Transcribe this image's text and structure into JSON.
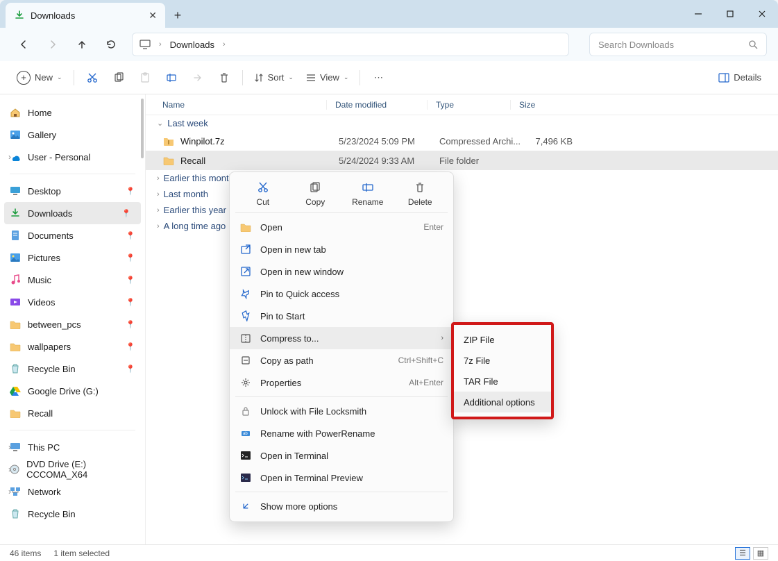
{
  "window": {
    "tab_title": "Downloads",
    "breadcrumb": [
      "Downloads"
    ],
    "search_placeholder": "Search Downloads"
  },
  "toolbar": {
    "new": "New",
    "sort": "Sort",
    "view": "View",
    "details": "Details"
  },
  "sidebar": {
    "top": [
      {
        "label": "Home",
        "icon": "home"
      },
      {
        "label": "Gallery",
        "icon": "gallery"
      },
      {
        "label": "User - Personal",
        "icon": "onedrive"
      }
    ],
    "quick": [
      {
        "label": "Desktop",
        "icon": "desktop"
      },
      {
        "label": "Downloads",
        "icon": "downloads",
        "active": true
      },
      {
        "label": "Documents",
        "icon": "documents"
      },
      {
        "label": "Pictures",
        "icon": "pictures"
      },
      {
        "label": "Music",
        "icon": "music"
      },
      {
        "label": "Videos",
        "icon": "videos"
      },
      {
        "label": "between_pcs",
        "icon": "folder"
      },
      {
        "label": "wallpapers",
        "icon": "folder"
      },
      {
        "label": "Recycle Bin",
        "icon": "recycle"
      },
      {
        "label": "Google Drive (G:)",
        "icon": "gdrive"
      },
      {
        "label": "Recall",
        "icon": "folder"
      }
    ],
    "bottom": [
      {
        "label": "This PC",
        "icon": "pc"
      },
      {
        "label": "DVD Drive (E:) CCCOMA_X64",
        "icon": "dvd"
      },
      {
        "label": "Network",
        "icon": "network"
      },
      {
        "label": "Recycle Bin",
        "icon": "recycle"
      }
    ]
  },
  "columns": {
    "name": "Name",
    "date": "Date modified",
    "type": "Type",
    "size": "Size"
  },
  "groups": [
    {
      "label": "Last week",
      "expanded": true,
      "rows": [
        {
          "name": "Winpilot.7z",
          "date": "5/23/2024 5:09 PM",
          "type": "Compressed Archi...",
          "size": "7,496 KB",
          "icon": "archive"
        },
        {
          "name": "Recall",
          "date": "5/24/2024 9:33 AM",
          "type": "File folder",
          "size": "",
          "icon": "folder",
          "selected": true
        }
      ]
    },
    {
      "label": "Earlier this month",
      "expanded": false
    },
    {
      "label": "Last month",
      "expanded": false
    },
    {
      "label": "Earlier this year",
      "expanded": false
    },
    {
      "label": "A long time ago",
      "expanded": false
    }
  ],
  "context_menu": {
    "top": [
      {
        "label": "Cut",
        "icon": "cut"
      },
      {
        "label": "Copy",
        "icon": "copy"
      },
      {
        "label": "Rename",
        "icon": "rename"
      },
      {
        "label": "Delete",
        "icon": "delete"
      }
    ],
    "items": [
      {
        "label": "Open",
        "hint": "Enter",
        "icon": "folder"
      },
      {
        "label": "Open in new tab",
        "icon": "newtab"
      },
      {
        "label": "Open in new window",
        "icon": "newwin"
      },
      {
        "label": "Pin to Quick access",
        "icon": "pin"
      },
      {
        "label": "Pin to Start",
        "icon": "pinstart"
      },
      {
        "label": "Compress to...",
        "icon": "compress",
        "submenu": true,
        "hover": true
      },
      {
        "label": "Copy as path",
        "hint": "Ctrl+Shift+C",
        "icon": "copypath"
      },
      {
        "label": "Properties",
        "hint": "Alt+Enter",
        "icon": "props"
      }
    ],
    "items2": [
      {
        "label": "Unlock with File Locksmith",
        "icon": "lock"
      },
      {
        "label": "Rename with PowerRename",
        "icon": "prename"
      },
      {
        "label": "Open in Terminal",
        "icon": "term"
      },
      {
        "label": "Open in Terminal Preview",
        "icon": "termp"
      }
    ],
    "more": {
      "label": "Show more options",
      "icon": "more"
    }
  },
  "submenu": [
    {
      "label": "ZIP File"
    },
    {
      "label": "7z File"
    },
    {
      "label": "TAR File"
    },
    {
      "label": "Additional options",
      "hover": true
    }
  ],
  "status": {
    "items": "46 items",
    "selected": "1 item selected"
  }
}
